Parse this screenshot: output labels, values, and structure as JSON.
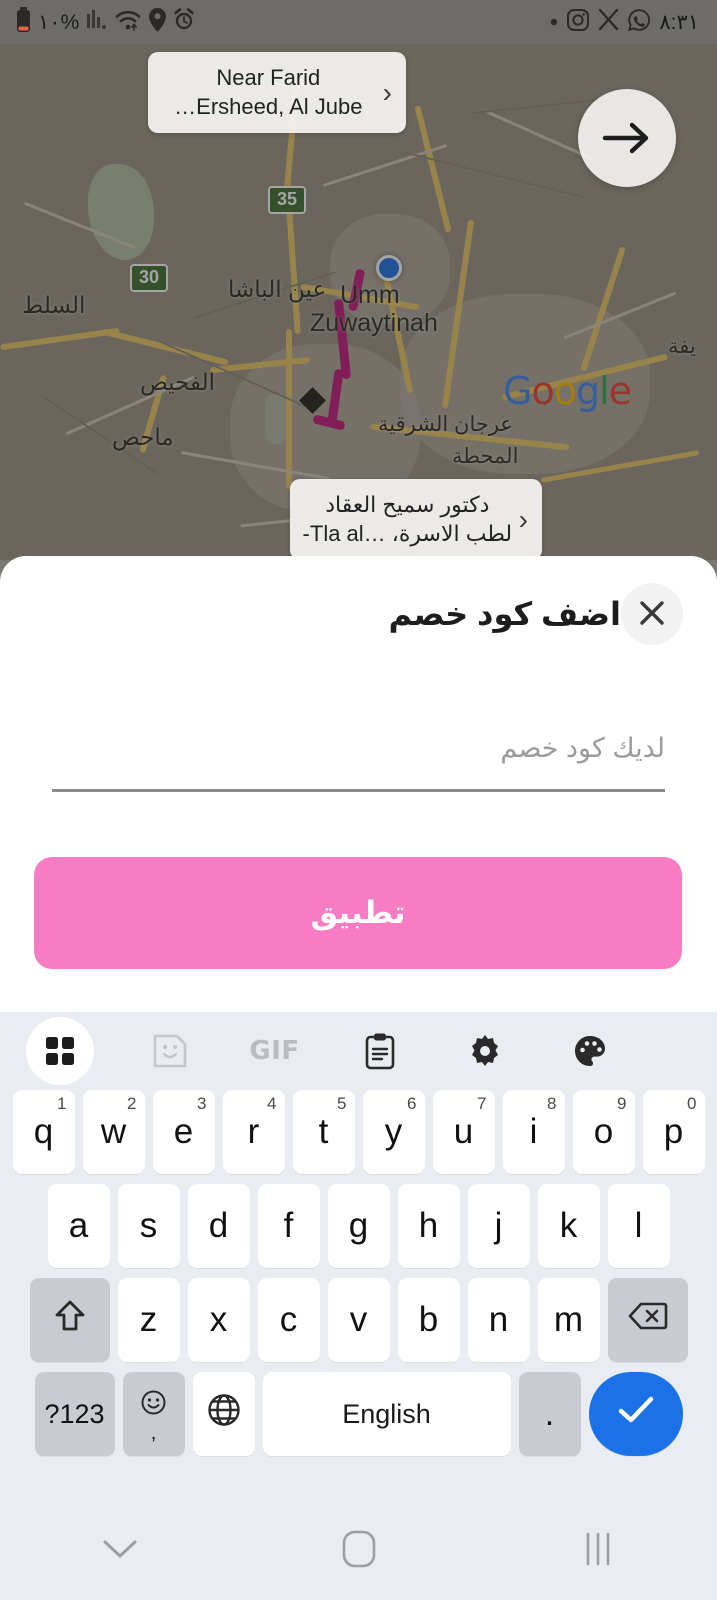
{
  "statusbar": {
    "battery_percent": "١٠%",
    "time": "٨:٣١",
    "left_icons": [
      "battery-low-icon",
      "signal-bars-icon",
      "wifi-icon",
      "location-pin-icon",
      "alarm-clock-icon"
    ],
    "right_icons": [
      "dot-indicator-icon",
      "instagram-icon",
      "x-twitter-icon",
      "whatsapp-icon"
    ]
  },
  "map": {
    "top_card": {
      "line1": "Near Farid",
      "line2": "Ersheed, Al Jube…",
      "chevron": "›"
    },
    "bottom_card": {
      "line1": "دكتور سميح العقاد",
      "line2": "لطب الاسرة، …Tla al-",
      "chevron": "›"
    },
    "fab": "arrow-right-icon",
    "shields": [
      "35",
      "30"
    ],
    "labels": {
      "ain_albasha": "عين الباشا",
      "umm_line1": "Umm",
      "umm_line2": "Zuwaytinah",
      "as_salt": "السلط",
      "fuheis": "الفحيص",
      "mahes": "ماحص",
      "arjan": "عرجان الشرقية",
      "mahatta": "المحطة",
      "edge_right": "يفة"
    },
    "attribution": {
      "g1": "G",
      "g2": "o",
      "g3": "o",
      "g4": "g",
      "g5": "l",
      "g6": "e"
    }
  },
  "sheet": {
    "title": "اضف كود خصم",
    "close_icon": "close-icon",
    "input": {
      "value": "",
      "placeholder": "لديك كود خصم"
    },
    "apply_label": "تطبيق",
    "accent_color": "#F77CC4"
  },
  "keyboard": {
    "toolbar": [
      "grid-apps-icon",
      "sticker-icon",
      "gif-icon",
      "clipboard-icon",
      "settings-gear-icon",
      "palette-icon"
    ],
    "gif_label": "GIF",
    "row1": [
      {
        "key": "q",
        "num": "1"
      },
      {
        "key": "w",
        "num": "2"
      },
      {
        "key": "e",
        "num": "3"
      },
      {
        "key": "r",
        "num": "4"
      },
      {
        "key": "t",
        "num": "5"
      },
      {
        "key": "y",
        "num": "6"
      },
      {
        "key": "u",
        "num": "7"
      },
      {
        "key": "i",
        "num": "8"
      },
      {
        "key": "o",
        "num": "9"
      },
      {
        "key": "p",
        "num": "0"
      }
    ],
    "row2": [
      "a",
      "s",
      "d",
      "f",
      "g",
      "h",
      "j",
      "k",
      "l"
    ],
    "row3": [
      "z",
      "x",
      "c",
      "v",
      "b",
      "n",
      "m"
    ],
    "shift_icon": "shift-arrow-icon",
    "backspace_icon": "backspace-icon",
    "symbols_label": "?123",
    "emoji_icon": "emoji-icon",
    "comma_label": ",",
    "globe_icon": "language-globe-icon",
    "space_label": "English",
    "period_label": ".",
    "enter_icon": "checkmark-icon"
  },
  "navbar": {
    "recents_icon": "recents-icon",
    "home_icon": "home-icon",
    "dismiss_icon": "chevron-down-icon"
  }
}
